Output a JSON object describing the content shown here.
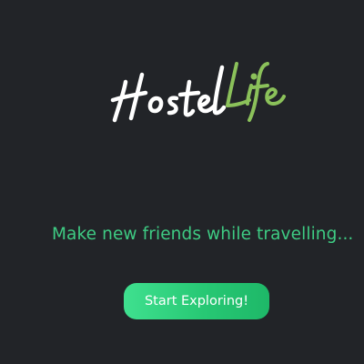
{
  "brand": {
    "name_part1": "Hostel",
    "name_part2": "Life",
    "color_part1": "#ffffff",
    "color_part2": "#8bc15a"
  },
  "hero": {
    "tagline": "Make new friends while travelling...",
    "tagline_color": "#3ecb83"
  },
  "cta": {
    "label": "Start Exploring!",
    "gradient_start": "#3fe08f",
    "gradient_end": "#1eb868"
  },
  "background_color": "#222428"
}
